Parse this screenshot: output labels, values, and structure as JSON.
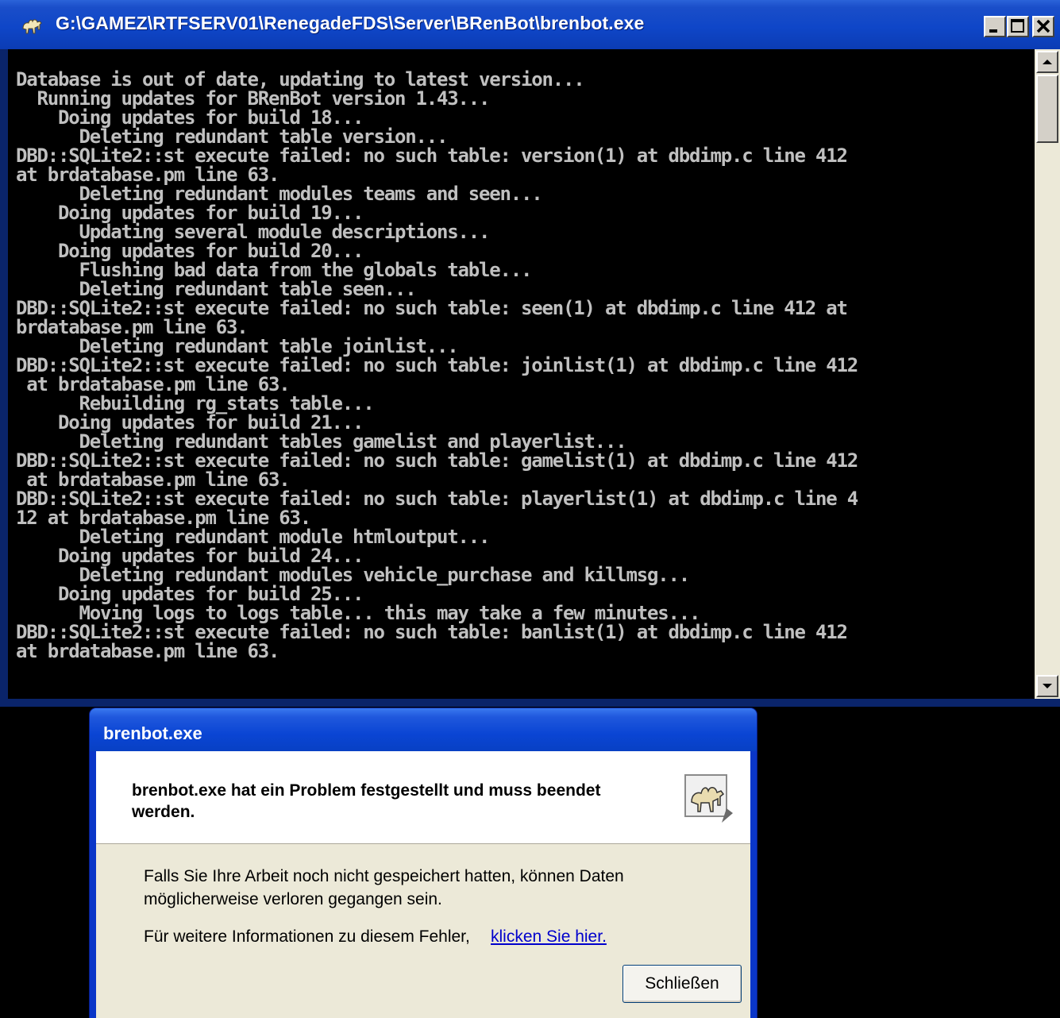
{
  "console": {
    "title": "G:\\GAMEZ\\RTFSERV01\\RenegadeFDS\\Server\\BRenBot\\brenbot.exe",
    "app_icon": "camel-icon",
    "output": "Database is out of date, updating to latest version...\n  Running updates for BRenBot version 1.43...\n    Doing updates for build 18...\n      Deleting redundant table version...\nDBD::SQLite2::st execute failed: no such table: version(1) at dbdimp.c line 412\nat brdatabase.pm line 63.\n      Deleting redundant modules teams and seen...\n    Doing updates for build 19...\n      Updating several module descriptions...\n    Doing updates for build 20...\n      Flushing bad data from the globals table...\n      Deleting redundant table seen...\nDBD::SQLite2::st execute failed: no such table: seen(1) at dbdimp.c line 412 at\nbrdatabase.pm line 63.\n      Deleting redundant table joinlist...\nDBD::SQLite2::st execute failed: no such table: joinlist(1) at dbdimp.c line 412\n at brdatabase.pm line 63.\n      Rebuilding rg_stats table...\n    Doing updates for build 21...\n      Deleting redundant tables gamelist and playerlist...\nDBD::SQLite2::st execute failed: no such table: gamelist(1) at dbdimp.c line 412\n at brdatabase.pm line 63.\nDBD::SQLite2::st execute failed: no such table: playerlist(1) at dbdimp.c line 4\n12 at brdatabase.pm line 63.\n      Deleting redundant module htmloutput...\n    Doing updates for build 24...\n      Deleting redundant modules vehicle_purchase and killmsg...\n    Doing updates for build 25...\n      Moving logs to logs table... this may take a few minutes...\nDBD::SQLite2::st execute failed: no such table: banlist(1) at dbdimp.c line 412\nat brdatabase.pm line 63."
  },
  "dialog": {
    "title": "brenbot.exe",
    "message": "brenbot.exe hat ein Problem festgestellt und muss beendet werden.",
    "info": "Falls Sie Ihre Arbeit noch nicht gespeichert hatten, können Daten möglicherweise verloren gegangen sein.",
    "more_info_text": "Für weitere Informationen zu diesem Fehler,",
    "more_info_link": "klicken Sie hier.",
    "close_label": "Schließen",
    "icon": "camel-icon"
  },
  "colors": {
    "titlebar": "#0b3cb4",
    "console_bg": "#000000",
    "console_fg": "#c0c0c0",
    "dialog_body": "#ece9d8",
    "link": "#0000cc"
  }
}
